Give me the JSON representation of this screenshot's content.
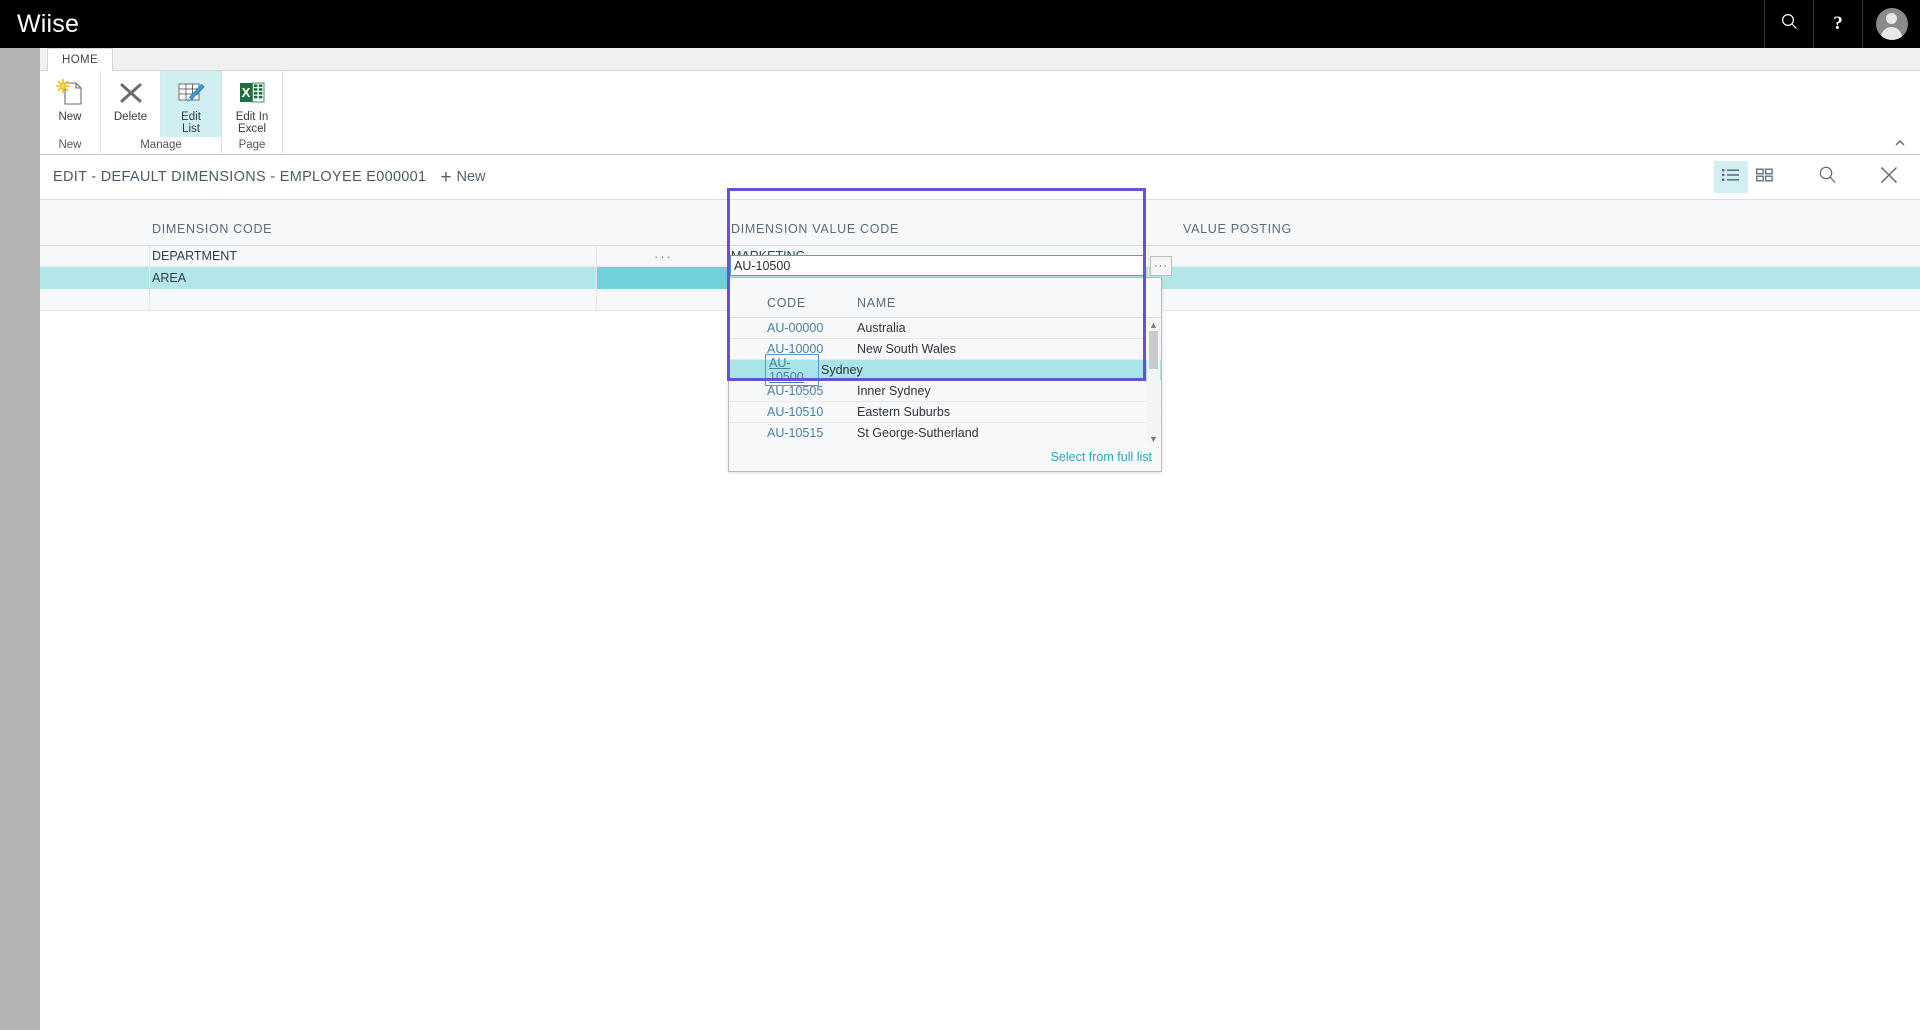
{
  "topbar": {
    "brand": "Wiise",
    "search_icon": "search-icon",
    "help_label": "?",
    "account_icon": "user-avatar-icon"
  },
  "ribbon": {
    "tab": "HOME",
    "groups": [
      {
        "label": "New",
        "buttons": [
          {
            "name": "new-button",
            "label": "New",
            "icon": "new-document-icon",
            "active": false
          }
        ]
      },
      {
        "label": "Manage",
        "buttons": [
          {
            "name": "delete-button",
            "label": "Delete",
            "icon": "delete-x-icon",
            "active": false
          },
          {
            "name": "edit-list-button",
            "label": "Edit\nList",
            "label_line1": "Edit",
            "label_line2": "List",
            "icon": "edit-list-icon",
            "active": true
          }
        ]
      },
      {
        "label": "Page",
        "buttons": [
          {
            "name": "edit-in-excel-button",
            "label_line1": "Edit In",
            "label_line2": "Excel",
            "icon": "excel-icon",
            "active": false
          }
        ]
      }
    ],
    "collapse_icon": "chevron-up-icon"
  },
  "page": {
    "title": "EDIT - DEFAULT DIMENSIONS - EMPLOYEE E000001",
    "new_action": "New",
    "actions": [
      {
        "name": "list-view-toggle",
        "icon": "list-view-icon",
        "selected": true
      },
      {
        "name": "tile-view-toggle",
        "icon": "tile-view-icon",
        "selected": false
      },
      {
        "name": "search-button",
        "icon": "search-icon",
        "selected": false
      },
      {
        "name": "close-button",
        "icon": "close-x-icon",
        "selected": false
      }
    ]
  },
  "grid": {
    "columns": [
      "DIMENSION CODE",
      "DIMENSION VALUE CODE",
      "VALUE POSTING"
    ],
    "rows": [
      {
        "dimension_code": "DEPARTMENT",
        "ellipsis": "···",
        "dimension_value_code": "MARKETING",
        "value_posting": "",
        "selected": false
      },
      {
        "dimension_code": "AREA",
        "ellipsis": "",
        "dimension_value_code": "AU-10500",
        "value_posting": "",
        "selected": true
      },
      {
        "dimension_code": "",
        "ellipsis": "",
        "dimension_value_code": "",
        "value_posting": "",
        "selected": false
      }
    ]
  },
  "editor": {
    "value": "AU-10500",
    "placeholder": "",
    "lookup_label": "···"
  },
  "dropdown": {
    "columns": {
      "code": "CODE",
      "name": "NAME"
    },
    "rows": [
      {
        "code": "AU-00000",
        "name": "Australia",
        "selected": false
      },
      {
        "code": "AU-10000",
        "name": "New South Wales",
        "selected": false
      },
      {
        "code": "AU-10500",
        "name": "Sydney",
        "selected": true
      },
      {
        "code": "AU-10505",
        "name": "Inner Sydney",
        "selected": false
      },
      {
        "code": "AU-10510",
        "name": "Eastern Suburbs",
        "selected": false
      },
      {
        "code": "AU-10515",
        "name": "St George-Sutherland",
        "selected": false
      }
    ],
    "footer_link": "Select from full list",
    "scroll_up_icon": "triangle-up-icon",
    "scroll_down_icon": "triangle-down-icon"
  },
  "colors": {
    "topbar_bg": "#000000",
    "highlight_border": "#6b4fd8",
    "row_selected": "#b2e6e8",
    "cell_selected_dark": "#6fd2da",
    "dropdown_selected": "#a8e4e8",
    "link": "#2aa8bd",
    "header_text": "#5a6a78",
    "code_text": "#4a7fa3",
    "ribbon_active": "#cfeff3"
  }
}
